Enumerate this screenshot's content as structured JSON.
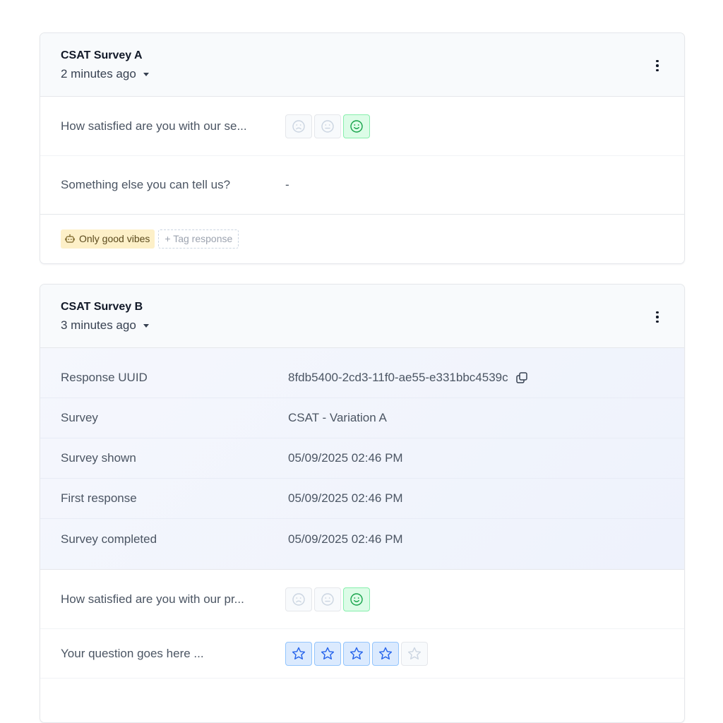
{
  "cards": [
    {
      "title": "CSAT Survey A",
      "time": "2 minutes ago",
      "questions": [
        {
          "label": "How satisfied are you with our se...",
          "rating": "happy"
        },
        {
          "label": "Something else you can tell us?",
          "value": "-"
        }
      ],
      "tags": [
        {
          "label": "Only good vibes",
          "icon": "robot-icon"
        }
      ],
      "add_tag_label": "+ Tag response"
    },
    {
      "title": "CSAT Survey B",
      "time": "3 minutes ago",
      "meta": [
        {
          "label": "Response UUID",
          "value": "8fdb5400-2cd3-11f0-ae55-e331bbc4539c",
          "copy": true
        },
        {
          "label": "Survey",
          "value": "CSAT - Variation A"
        },
        {
          "label": "Survey shown",
          "value": "05/09/2025 02:46 PM"
        },
        {
          "label": "First response",
          "value": "05/09/2025 02:46 PM"
        },
        {
          "label": "Survey completed",
          "value": "05/09/2025 02:46 PM"
        }
      ],
      "questions": [
        {
          "label": "How satisfied are you with our pr...",
          "rating": "happy"
        },
        {
          "label": "Your question goes here ...",
          "stars": 4,
          "stars_max": 5
        }
      ]
    }
  ],
  "colors": {
    "accent_green": "#22c55e",
    "accent_blue": "#3b82f6",
    "tag_bg": "#fdf0c8"
  }
}
